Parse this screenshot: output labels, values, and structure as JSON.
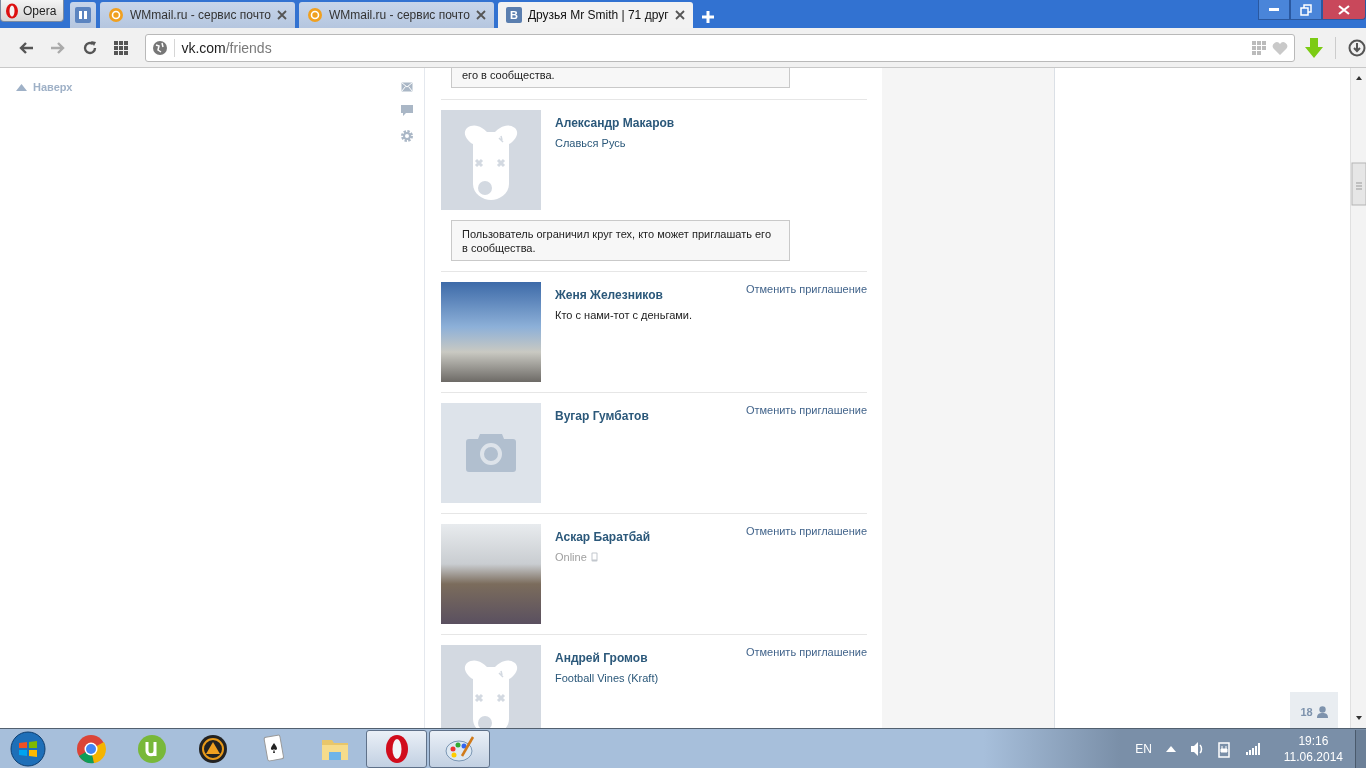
{
  "browser": {
    "menu_button": "Opera",
    "tabs": [
      {
        "kind": "pinned",
        "selected": false
      },
      {
        "kind": "mail",
        "title": "WMmail.ru - сервис почто",
        "selected": false
      },
      {
        "kind": "mail",
        "title": "WMmail.ru - сервис почто",
        "selected": false
      },
      {
        "kind": "vk",
        "icon_text": "В",
        "title": "Друзья Mr Smith | 71 друг",
        "selected": true
      }
    ],
    "address": {
      "host": "vk.com",
      "path": "/friends"
    }
  },
  "page": {
    "back_to_top": "Наверх",
    "top_notice": "его в сообщества.",
    "friends": [
      {
        "name": "Александр Макаров",
        "avatar": {
          "kind": "deactivated"
        },
        "status": {
          "kind": "link",
          "text": "Славься Русь"
        },
        "notice": "Пользователь ограничил круг тех, кто может приглашать его в сообщества."
      },
      {
        "name": "Женя Железников",
        "avatar": {
          "kind": "photo"
        },
        "status": {
          "kind": "text",
          "text": "Кто с нами-тот с деньгами."
        },
        "action": "Отменить приглашение"
      },
      {
        "name": "Вугар Гумбатов",
        "avatar": {
          "kind": "no_photo"
        },
        "action": "Отменить приглашение"
      },
      {
        "name": "Аскар Баратбай",
        "avatar": {
          "kind": "photo"
        },
        "status": {
          "kind": "online",
          "text": "Online",
          "mobile": true
        },
        "action": "Отменить приглашение"
      },
      {
        "name": "Андрей Громов",
        "avatar": {
          "kind": "deactivated"
        },
        "status": {
          "kind": "link",
          "text": "Football Vines (Kraft)"
        },
        "action": "Отменить приглашение"
      }
    ],
    "online_counter": "18"
  },
  "taskbar": {
    "apps": [
      {
        "kind": "chrome",
        "running": false
      },
      {
        "kind": "torrent",
        "running": false
      },
      {
        "kind": "player",
        "running": false
      },
      {
        "kind": "cards",
        "running": false
      },
      {
        "kind": "folder",
        "running": false
      },
      {
        "kind": "opera",
        "running": true
      },
      {
        "kind": "paint",
        "running": true
      }
    ],
    "language": "EN",
    "time": "19:16",
    "date": "11.06.2014"
  }
}
